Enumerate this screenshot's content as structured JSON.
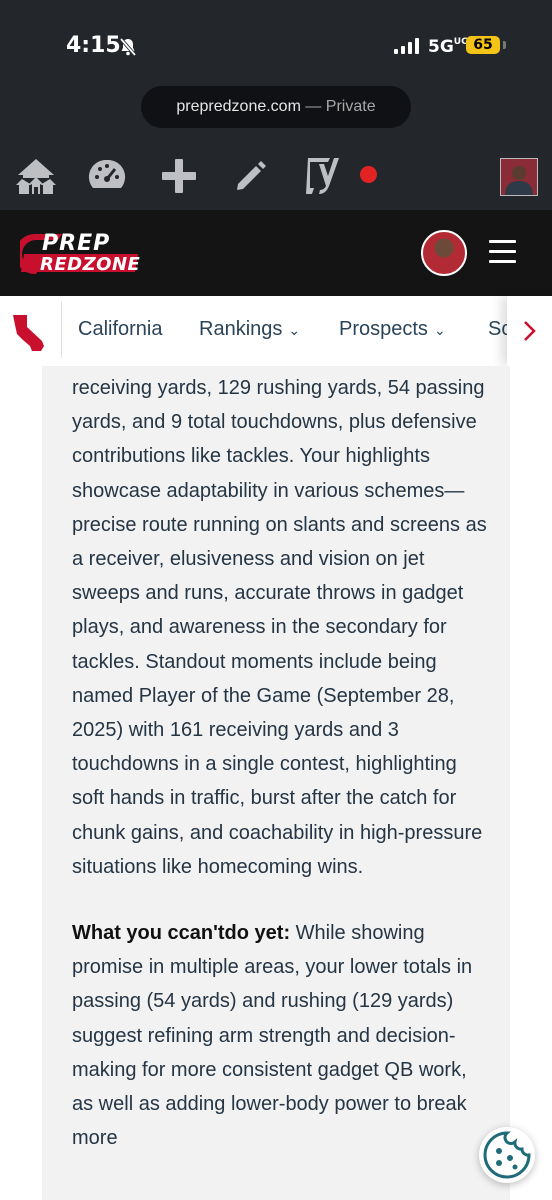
{
  "status_bar": {
    "time": "4:15",
    "network": "5G",
    "network_suffix": "UC",
    "battery": "65",
    "battery_color": "#f3c318"
  },
  "browser": {
    "url": "prepredzone.com",
    "mode": "— Private"
  },
  "admin_bar": {
    "icons": [
      "home-network-icon",
      "dashboard-gauge-icon",
      "plus-icon",
      "pencil-icon",
      "yoast-icon"
    ],
    "seo_status_color": "#e22323"
  },
  "site": {
    "logo_top": "PREP",
    "logo_bottom": "REDZONE",
    "brand_color": "#c8102e"
  },
  "nav": {
    "state_icon": "california-map-icon",
    "items": [
      {
        "label": "California",
        "dropdown": false
      },
      {
        "label": "Rankings",
        "dropdown": true
      },
      {
        "label": "Prospects",
        "dropdown": true
      },
      {
        "label": "Sc",
        "dropdown": false
      }
    ]
  },
  "article": {
    "p1": "receiving yards, 129 rushing yards, 54 passing yards, and 9 total touchdowns, plus defensive contributions like tackles. Your highlights showcase adaptability in various schemes—precise route running on slants and screens as a receiver, elusiveness and vision on jet sweeps and runs, accurate throws in gadget plays, and awareness in the secondary for tackles. Standout moments include being named Player of the Game (September 28, 2025) with 161 receiving yards and 3 touchdowns in a single contest, highlighting soft hands in traffic, burst after the catch for chunk gains, and coachability in high-pressure situations like homecoming wins.",
    "p2_heading": "What you ccan'tdo yet:",
    "p2_body": "While showing promise in multiple areas, your lower totals in passing (54 yards) and rushing (129 yards) suggest refining arm strength and decision-making for more consistent gadget QB work, as well as adding lower-body power to break more"
  }
}
